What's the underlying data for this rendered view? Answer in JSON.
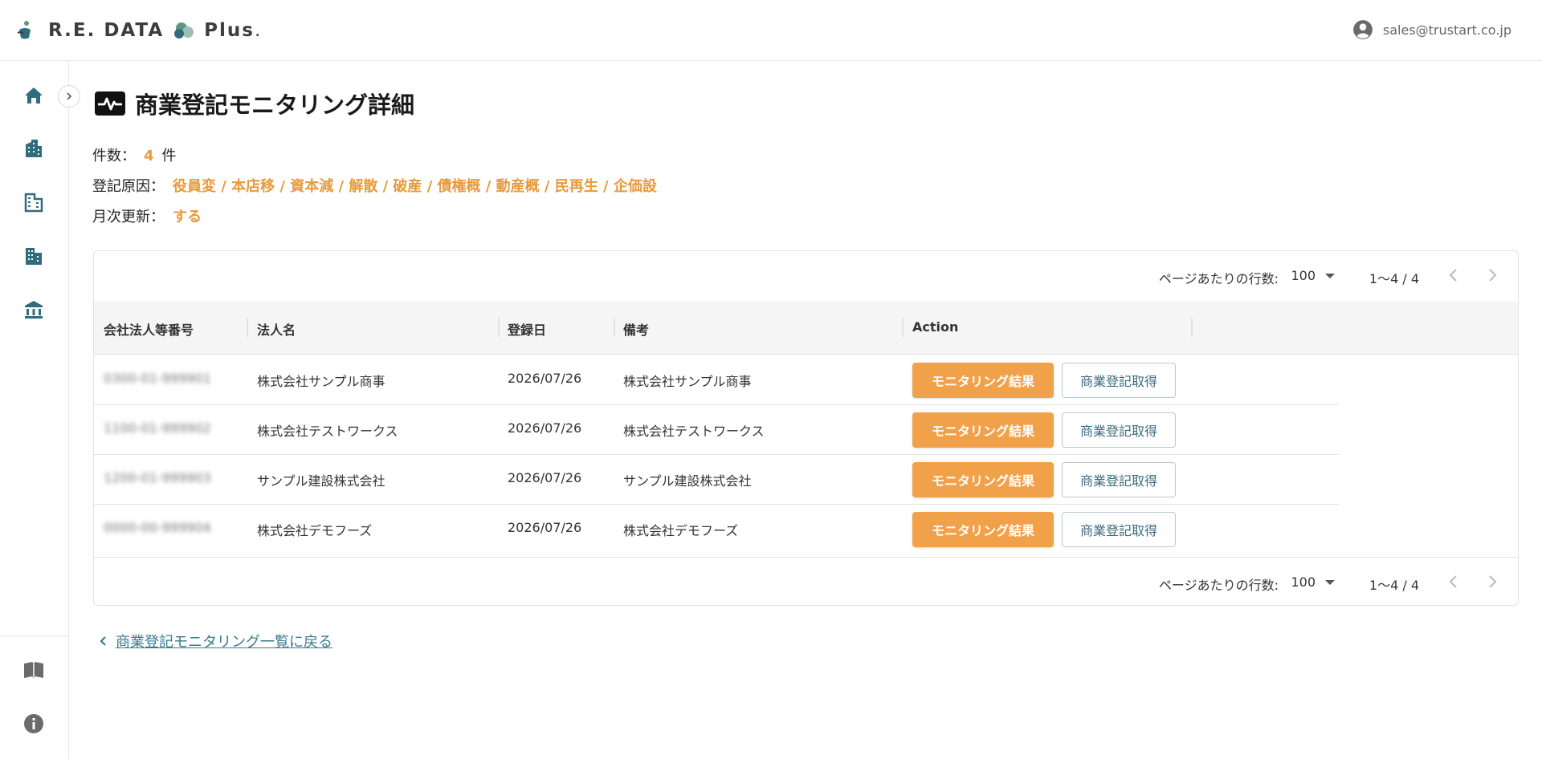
{
  "header": {
    "logo_text": "R.E. DATA",
    "logo_plus": "Plus",
    "logo_dot": ".",
    "user_email": "sales@trustart.co.jp"
  },
  "page": {
    "title": "商業登記モニタリング詳細"
  },
  "meta": {
    "count_label": "件数：",
    "count_value": "4",
    "count_unit": "件",
    "reason_label": "登記原因：",
    "reason_value": "役員変 / 本店移 / 資本減 / 解散 / 破産 / 債権概 / 動産概 / 民再生 / 企価設",
    "monthly_label": "月次更新：",
    "monthly_value": "する"
  },
  "pager": {
    "rows_label": "ページあたりの行数:",
    "rows_value": "100",
    "range": "1〜4 / 4"
  },
  "table": {
    "columns": [
      "会社法人等番号",
      "法人名",
      "登録日",
      "備考",
      "Action"
    ],
    "rows": [
      {
        "number": "0300-01-999901",
        "name": "株式会社サンプル商事",
        "date": "2026/07/26",
        "note": "株式会社サンプル商事"
      },
      {
        "number": "1100-01-999902",
        "name": "株式会社テストワークス",
        "date": "2026/07/26",
        "note": "株式会社テストワークス"
      },
      {
        "number": "1200-01-999903",
        "name": "サンプル建設株式会社",
        "date": "2026/07/26",
        "note": "サンプル建設株式会社"
      },
      {
        "number": "0000-00-999904",
        "name": "株式会社デモフーズ",
        "date": "2026/07/26",
        "note": "株式会社デモフーズ"
      }
    ],
    "action_primary": "モニタリング結果",
    "action_secondary": "商業登記取得"
  },
  "back_link": "商業登記モニタリング一覧に戻る",
  "colors": {
    "accent": "#f2a14b",
    "teal": "#3a7a8e",
    "value_orange": "#e89a3c"
  }
}
